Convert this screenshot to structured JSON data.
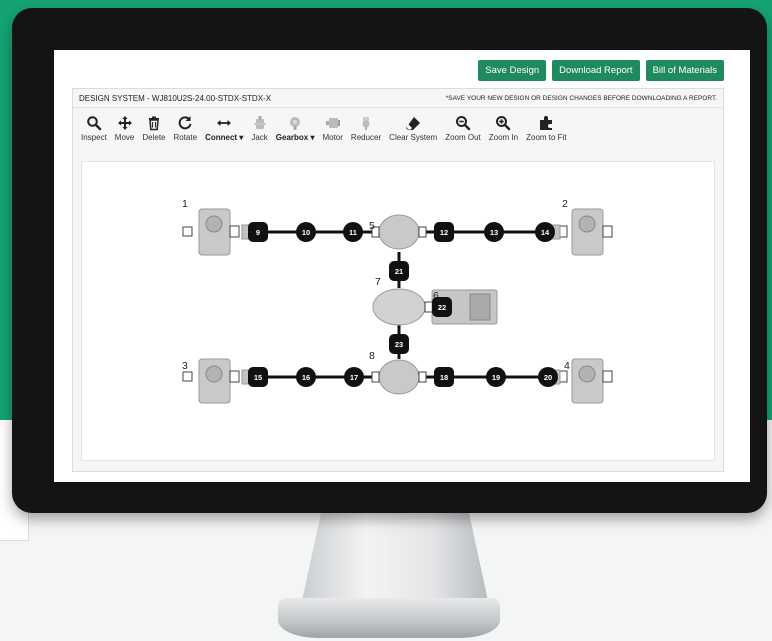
{
  "colors": {
    "brand_green": "#15a374",
    "button_green": "#1f8a5e",
    "monitor_bezel": "#141414"
  },
  "topbar": {
    "save_design": "Save Design",
    "download_report": "Download Report",
    "bill_of_materials": "Bill of Materials"
  },
  "design": {
    "title": "DESIGN SYSTEM - WJ810U2S-24.00-STDX-STDX-X",
    "notice": "*SAVE YOUR NEW DESIGN OR DESIGN CHANGES BEFORE DOWNLOADING A REPORT."
  },
  "toolbar": [
    {
      "label": "Inspect",
      "icon": "search-icon"
    },
    {
      "label": "Move",
      "icon": "move-icon"
    },
    {
      "label": "Delete",
      "icon": "trash-icon"
    },
    {
      "label": "Rotate",
      "icon": "rotate-icon"
    },
    {
      "label": "Connect ▾",
      "icon": "connect-arrows-icon"
    },
    {
      "label": "Jack",
      "icon": "jack-icon"
    },
    {
      "label": "Gearbox ▾",
      "icon": "gearbox-icon"
    },
    {
      "label": "Motor",
      "icon": "motor-icon"
    },
    {
      "label": "Reducer",
      "icon": "reducer-icon"
    },
    {
      "label": "Clear System",
      "icon": "eraser-icon"
    },
    {
      "label": "Zoom Out",
      "icon": "zoom-out-icon"
    },
    {
      "label": "Zoom In",
      "icon": "zoom-in-icon"
    },
    {
      "label": "Zoom to Fit",
      "icon": "puzzle-icon"
    }
  ],
  "diagram": {
    "component_labels": [
      "1",
      "2",
      "3",
      "4",
      "5",
      "6",
      "7",
      "8"
    ],
    "shafts": [
      "9",
      "10",
      "11",
      "12",
      "13",
      "14",
      "15",
      "16",
      "17",
      "18",
      "19",
      "20",
      "21",
      "22",
      "23"
    ]
  }
}
